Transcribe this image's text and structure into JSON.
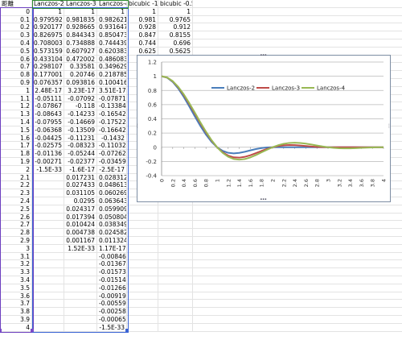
{
  "sheet": {
    "headers": [
      "距離",
      "Lanczos-2",
      "Lanczos-3",
      "Lanczos-4",
      "bicubic -1",
      "bicubic -0.5"
    ],
    "rows": [
      [
        "0",
        "1",
        "1",
        "1",
        "1",
        "1"
      ],
      [
        "0.1",
        "0.979592",
        "0.981835",
        "0.982621",
        "0.981",
        "0.9765"
      ],
      [
        "0.2",
        "0.920177",
        "0.928665",
        "0.931647",
        "0.928",
        "0.912"
      ],
      [
        "0.3",
        "0.826975",
        "0.844343",
        "0.850473",
        "0.847",
        "0.8155"
      ],
      [
        "0.4",
        "0.708003",
        "0.734888",
        "0.744439",
        "0.744",
        "0.696"
      ],
      [
        "0.5",
        "0.573159",
        "0.607927",
        "0.620383",
        "0.625",
        "0.5625"
      ],
      [
        "0.6",
        "0.433104",
        "0.472002",
        "0.486083",
        "",
        ""
      ],
      [
        "0.7",
        "0.298107",
        "0.33581",
        "0.349629",
        "",
        ""
      ],
      [
        "0.8",
        "0.177001",
        "0.20746",
        "0.218785",
        "",
        ""
      ],
      [
        "0.9",
        "0.076357",
        "0.093816",
        "0.100416",
        "",
        ""
      ],
      [
        "1",
        "2.48E-17",
        "3.23E-17",
        "3.51E-17",
        "",
        ""
      ],
      [
        "1.1",
        "-0.05111",
        "-0.07092",
        "-0.07871",
        "",
        ""
      ],
      [
        "1.2",
        "-0.07867",
        "-0.118",
        "-0.13384",
        "",
        ""
      ],
      [
        "1.3",
        "-0.08643",
        "-0.14233",
        "-0.16542",
        "",
        ""
      ],
      [
        "1.4",
        "-0.07955",
        "-0.14669",
        "-0.17522",
        "",
        ""
      ],
      [
        "1.5",
        "-0.06368",
        "-0.13509",
        "-0.16642",
        "",
        ""
      ],
      [
        "1.6",
        "-0.04425",
        "-0.11231",
        "-0.1432",
        "",
        ""
      ],
      [
        "1.7",
        "-0.02575",
        "-0.08323",
        "-0.11032",
        "",
        ""
      ],
      [
        "1.8",
        "-0.01136",
        "-0.05244",
        "-0.07262",
        "",
        ""
      ],
      [
        "1.9",
        "-0.00271",
        "-0.02377",
        "-0.03459",
        "",
        ""
      ],
      [
        "2",
        "-1.5E-33",
        "-1.6E-17",
        "-2.5E-17",
        "",
        ""
      ],
      [
        "2.1",
        "",
        "0.017231",
        "0.028312",
        "",
        ""
      ],
      [
        "2.2",
        "",
        "0.027433",
        "0.048613",
        "",
        ""
      ],
      [
        "2.3",
        "",
        "0.031105",
        "0.060269",
        "",
        ""
      ],
      [
        "2.4",
        "",
        "0.0295",
        "0.063643",
        "",
        ""
      ],
      [
        "2.5",
        "",
        "0.024317",
        "0.059909",
        "",
        ""
      ],
      [
        "2.6",
        "",
        "0.017394",
        "0.050804",
        "",
        ""
      ],
      [
        "2.7",
        "",
        "0.010424",
        "0.038349",
        "",
        ""
      ],
      [
        "2.8",
        "",
        "0.004738",
        "0.024582",
        "",
        ""
      ],
      [
        "2.9",
        "",
        "0.001167",
        "0.011324",
        "",
        ""
      ],
      [
        "3",
        "",
        "1.52E-33",
        "1.17E-17",
        "",
        ""
      ],
      [
        "3.1",
        "",
        "",
        "-0.00846",
        "",
        ""
      ],
      [
        "3.2",
        "",
        "",
        "-0.01367",
        "",
        ""
      ],
      [
        "3.3",
        "",
        "",
        "-0.01573",
        "",
        ""
      ],
      [
        "3.4",
        "",
        "",
        "-0.01514",
        "",
        ""
      ],
      [
        "3.5",
        "",
        "",
        "-0.01266",
        "",
        ""
      ],
      [
        "3.6",
        "",
        "",
        "-0.00919",
        "",
        ""
      ],
      [
        "3.7",
        "",
        "",
        "-0.00559",
        "",
        ""
      ],
      [
        "3.8",
        "",
        "",
        "-0.00258",
        "",
        ""
      ],
      [
        "3.9",
        "",
        "",
        "-0.00065",
        "",
        ""
      ],
      [
        "4",
        "",
        "",
        "-1.5E-33",
        "",
        ""
      ]
    ]
  },
  "chart_data": {
    "type": "line",
    "x": [
      0,
      0.1,
      0.2,
      0.3,
      0.4,
      0.5,
      0.6,
      0.7,
      0.8,
      0.9,
      1,
      1.1,
      1.2,
      1.3,
      1.4,
      1.5,
      1.6,
      1.7,
      1.8,
      1.9,
      2,
      2.1,
      2.2,
      2.3,
      2.4,
      2.5,
      2.6,
      2.7,
      2.8,
      2.9,
      3,
      3.1,
      3.2,
      3.3,
      3.4,
      3.5,
      3.6,
      3.7,
      3.8,
      3.9,
      4
    ],
    "x_tick_labels": [
      "0",
      "0.2",
      "0.4",
      "0.6",
      "0.8",
      "1",
      "1.2",
      "1.4",
      "1.6",
      "1.8",
      "2",
      "2.2",
      "2.4",
      "2.6",
      "2.8",
      "3",
      "3.2",
      "3.4",
      "3.6",
      "3.8",
      "4"
    ],
    "ylim": [
      -0.4,
      1.2
    ],
    "y_ticks": [
      "1.2",
      "1",
      "0.8",
      "0.6",
      "0.4",
      "0.2",
      "0",
      "-0.2",
      "-0.4"
    ],
    "grid": true,
    "legend_position": "top",
    "series": [
      {
        "name": "Lanczos-2",
        "color": "#4a7ebb",
        "values": [
          1,
          0.979592,
          0.920177,
          0.826975,
          0.708003,
          0.573159,
          0.433104,
          0.298107,
          0.177001,
          0.076357,
          0,
          -0.05111,
          -0.07867,
          -0.08643,
          -0.07955,
          -0.06368,
          -0.04425,
          -0.02575,
          -0.01136,
          -0.00271,
          0,
          0,
          0,
          0,
          0,
          0,
          0,
          0,
          0,
          0,
          0,
          0,
          0,
          0,
          0,
          0,
          0,
          0,
          0,
          0,
          0
        ]
      },
      {
        "name": "Lanczos-3",
        "color": "#be4b48",
        "values": [
          1,
          0.981835,
          0.928665,
          0.844343,
          0.734888,
          0.607927,
          0.472002,
          0.33581,
          0.20746,
          0.093816,
          0,
          -0.07092,
          -0.118,
          -0.14233,
          -0.14669,
          -0.13509,
          -0.11231,
          -0.08323,
          -0.05244,
          -0.02377,
          0,
          0.017231,
          0.027433,
          0.031105,
          0.0295,
          0.024317,
          0.017394,
          0.010424,
          0.004738,
          0.001167,
          0,
          0,
          0,
          0,
          0,
          0,
          0,
          0,
          0,
          0,
          0
        ]
      },
      {
        "name": "Lanczos-4",
        "color": "#98b954",
        "values": [
          1,
          0.982621,
          0.931647,
          0.850473,
          0.744439,
          0.620383,
          0.486083,
          0.349629,
          0.218785,
          0.100416,
          0,
          -0.07871,
          -0.13384,
          -0.16542,
          -0.17522,
          -0.16642,
          -0.1432,
          -0.11032,
          -0.07262,
          -0.03459,
          0,
          0.028312,
          0.048613,
          0.060269,
          0.063643,
          0.059909,
          0.050804,
          0.038349,
          0.024582,
          0.011324,
          0,
          -0.00846,
          -0.01367,
          -0.01573,
          -0.01514,
          -0.01266,
          -0.00919,
          -0.00559,
          -0.00258,
          -0.00065,
          0
        ]
      }
    ]
  }
}
